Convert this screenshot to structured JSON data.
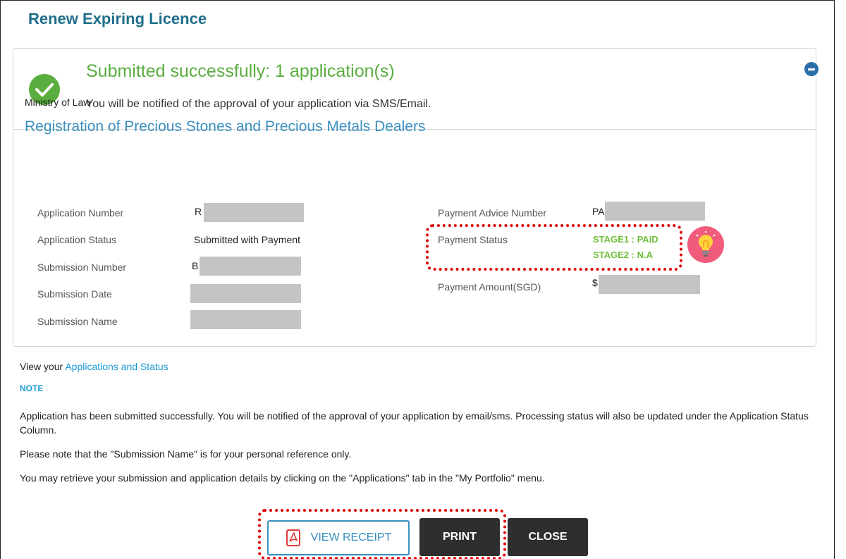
{
  "page": {
    "title": "Renew Expiring Licence"
  },
  "success": {
    "title": "Submitted successfully: 1 application(s)",
    "subtitle": "You will be notified of the approval of your application via SMS/Email."
  },
  "details": {
    "agency": "Ministry of Law",
    "service": "Registration of Precious Stones and Precious Metals Dealers",
    "left": [
      {
        "label": "Application Number",
        "value": "R"
      },
      {
        "label": "Application Status",
        "value": "Submitted with Payment"
      },
      {
        "label": "Submission Number",
        "value": "B"
      },
      {
        "label": "Submission Date",
        "value": ""
      },
      {
        "label": "Submission Name",
        "value": ""
      }
    ],
    "right": [
      {
        "label": "Payment Advice Number",
        "value": "PA"
      },
      {
        "label": "Payment Status",
        "value": "STAGE1 : PAID",
        "value2": "STAGE2 : N.A"
      },
      {
        "label": "Payment Amount(SGD)",
        "value": "$"
      }
    ]
  },
  "footer": {
    "view_prefix": "View your",
    "view_link": "Applications and Status",
    "note_heading": "NOTE",
    "paragraphs": [
      "Application has been submitted successfully. You will be notified of the approval of your application by email/sms. Processing status will also be updated under the Application Status Column.",
      "Please note that the \"Submission Name\" is for your personal reference only.",
      "You may retrieve your submission and application details by clicking on the \"Applications\" tab in the \"My Portfolio\" menu."
    ]
  },
  "buttons": {
    "view_receipt": "VIEW RECEIPT",
    "print": "PRINT",
    "close": "CLOSE"
  },
  "colors": {
    "accent": "#3a8fc0",
    "success": "#5aad3f",
    "paid": "#6fbf3a",
    "highlight": "#e00000",
    "dark_button": "#2e2e2e"
  },
  "icons": [
    "check-icon",
    "collapse-icon",
    "pdf-icon",
    "lightbulb-icon"
  ]
}
